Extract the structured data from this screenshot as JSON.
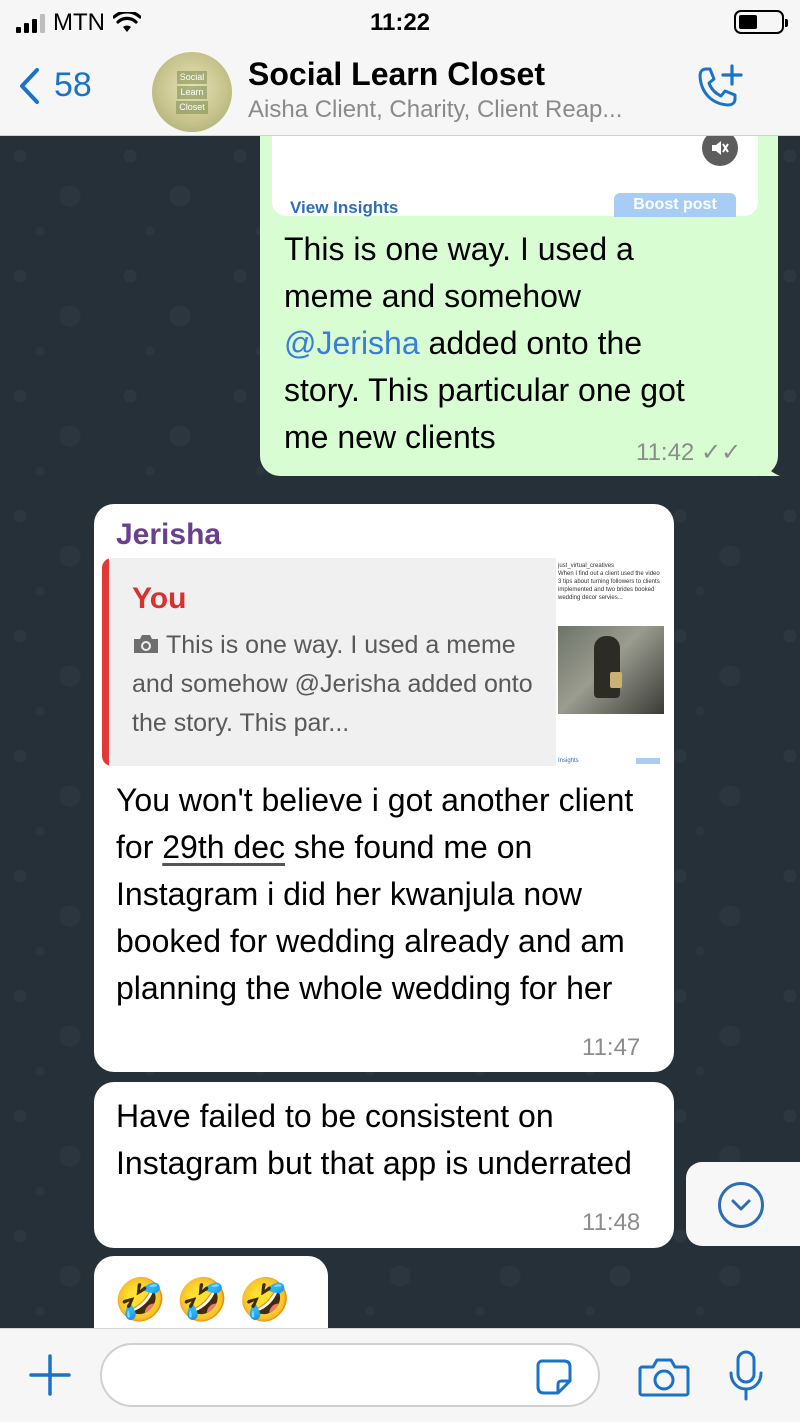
{
  "status_bar": {
    "carrier": "MTN",
    "time": "11:22"
  },
  "header": {
    "back_count": "58",
    "avatar_lines": [
      "Social",
      "Learn",
      "Closet"
    ],
    "title": "Social Learn Closet",
    "subtitle": "Aisha Client, Charity, Client Reap..."
  },
  "messages": {
    "m1": {
      "insights_label": "View Insights",
      "boost_label": "Boost post",
      "text_before": "This is one way. I used a meme and somehow ",
      "mention": "@Jerisha",
      "text_after": " added onto the story. This particular one got me new clients",
      "time": "11:42",
      "ticks": "✓✓"
    },
    "m2": {
      "sender": "Jerisha",
      "quote_author": "You",
      "quote_text": "This is one way. I used a meme and somehow @Jerisha added onto the story. This par...",
      "thumb_lines": [
        "just_virtual_creatives",
        "When I find out a client used the video",
        "3 tips about turning followers to clients",
        "implemented and two brides booked",
        "wedding decor servies..."
      ],
      "thumb_insights": "Insights",
      "text_before": "You won't believe i got another client for ",
      "date": "29th dec",
      "text_after": " she found me on Instagram i did her kwanjula now booked for wedding already and am planning the whole wedding for her",
      "time": "11:47"
    },
    "m3": {
      "text": "Have failed to be consistent on Instagram but that app is underrated",
      "time": "11:48"
    },
    "m4": {
      "emoji": "🤣🤣🤣"
    }
  },
  "input": {
    "placeholder": ""
  }
}
